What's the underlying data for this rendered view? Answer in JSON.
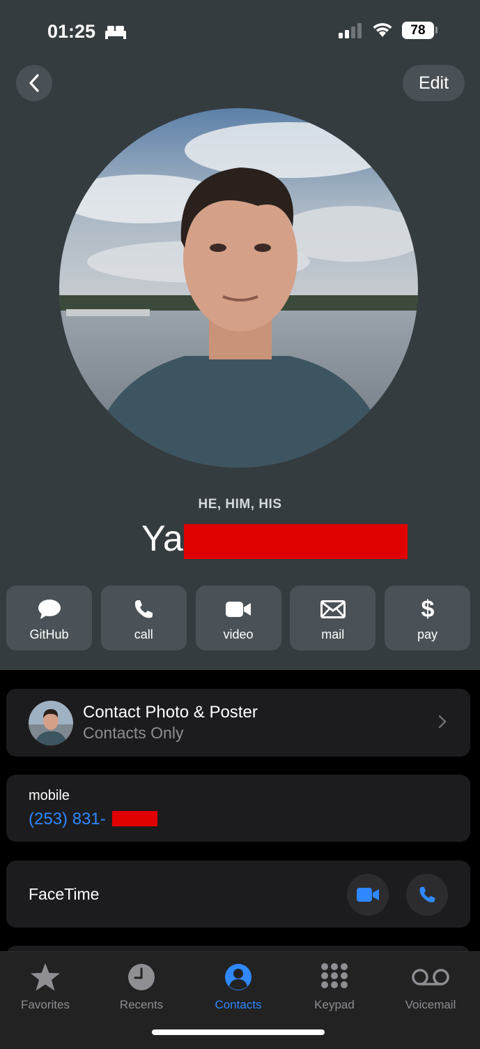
{
  "status_bar": {
    "time": "01:25",
    "battery": "78"
  },
  "nav": {
    "edit_label": "Edit"
  },
  "contact": {
    "pronouns": "HE, HIM, HIS",
    "name_visible": "Ya"
  },
  "actions": [
    {
      "label": "GitHub",
      "icon": "message-icon"
    },
    {
      "label": "call",
      "icon": "phone-icon"
    },
    {
      "label": "video",
      "icon": "video-icon"
    },
    {
      "label": "mail",
      "icon": "mail-icon"
    },
    {
      "label": "pay",
      "icon": "dollar-icon"
    }
  ],
  "poster_card": {
    "title": "Contact Photo & Poster",
    "subtitle": "Contacts Only"
  },
  "phone_card": {
    "label": "mobile",
    "number_visible": "(253) 831-"
  },
  "facetime_card": {
    "label": "FaceTime"
  },
  "tabs": [
    {
      "label": "Favorites",
      "icon": "star-icon"
    },
    {
      "label": "Recents",
      "icon": "clock-icon"
    },
    {
      "label": "Contacts",
      "icon": "person-icon",
      "active": true
    },
    {
      "label": "Keypad",
      "icon": "keypad-icon"
    },
    {
      "label": "Voicemail",
      "icon": "voicemail-icon"
    }
  ],
  "colors": {
    "accent": "#2f88ff",
    "header_bg": "#343c40",
    "redaction": "#e10000"
  }
}
